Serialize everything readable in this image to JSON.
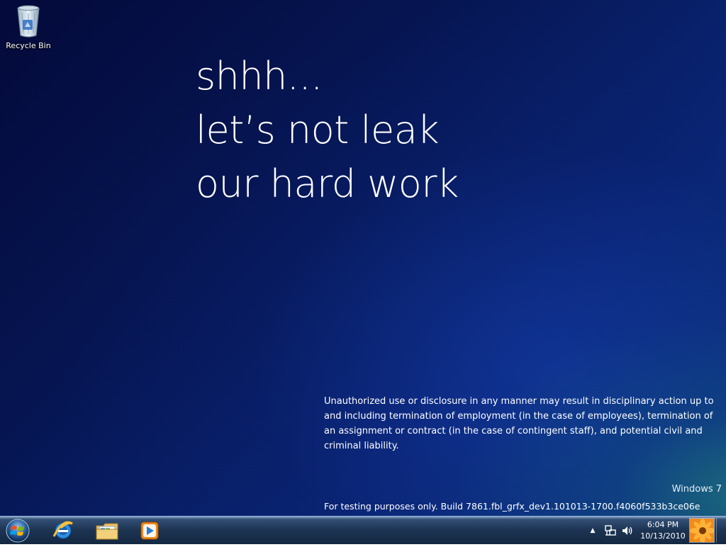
{
  "desktop": {
    "icons": [
      {
        "label": "Recycle Bin",
        "icon": "recycle-bin-icon"
      }
    ],
    "headline": [
      "shhh...",
      "let’s not leak",
      "our hard work"
    ],
    "legal_text": "Unauthorized use or disclosure in any manner may result in disciplinary action up to and including termination of employment (in the case of employees), termination of an assignment or contract (in the case of contingent staff), and potential civil and criminal liability.",
    "watermark": {
      "os_name": "Windows 7",
      "build_text": "For testing purposes only. Build 7861.fbl_grfx_dev1.101013-1700.f4060f533b3ce06e"
    }
  },
  "taskbar": {
    "start_icon": "windows-orb-icon",
    "pinned": [
      {
        "name": "internet-explorer",
        "icon": "internet-explorer-icon"
      },
      {
        "name": "windows-explorer",
        "icon": "folder-library-icon"
      },
      {
        "name": "media-player",
        "icon": "media-player-icon"
      }
    ],
    "tray": {
      "overflow_icon": "chevron-up-icon",
      "network_icon": "network-icon",
      "volume_icon": "speaker-icon",
      "time": "6:04 PM",
      "date": "10/13/2010"
    }
  },
  "colors": {
    "desktop_dark": "#040a3a",
    "desktop_mid": "#0a2676",
    "desktop_accent": "#2f8f7a",
    "taskbar": "#1c3352"
  }
}
